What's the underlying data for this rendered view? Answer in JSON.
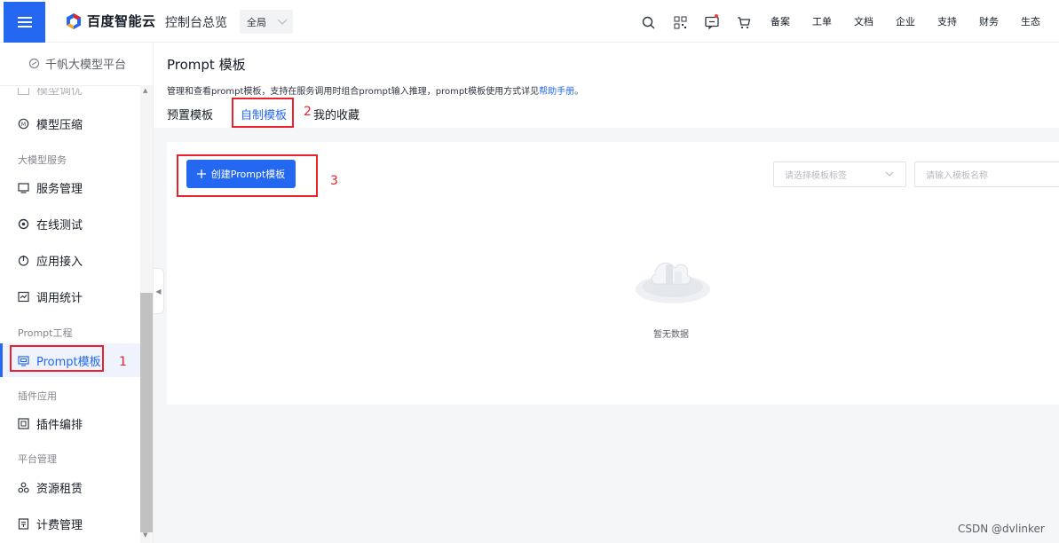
{
  "topbar": {
    "brand": "百度智能云",
    "console_title": "控制台总览",
    "region": "全局",
    "links": [
      "备案",
      "工单",
      "文档",
      "企业",
      "支持",
      "财务",
      "生态"
    ],
    "icons": [
      "search-icon",
      "qrcode-icon",
      "message-icon",
      "cart-icon"
    ]
  },
  "sidebar": {
    "platform": "千帆大模型平台",
    "partial_item": "模型调优",
    "items": [
      {
        "type": "item",
        "label": "模型压缩",
        "icon": "compress-icon"
      },
      {
        "type": "group",
        "label": "大模型服务"
      },
      {
        "type": "item",
        "label": "服务管理",
        "icon": "service-icon"
      },
      {
        "type": "item",
        "label": "在线测试",
        "icon": "test-icon"
      },
      {
        "type": "item",
        "label": "应用接入",
        "icon": "plug-icon"
      },
      {
        "type": "item",
        "label": "调用统计",
        "icon": "stats-icon"
      },
      {
        "type": "group",
        "label": "Prompt工程"
      },
      {
        "type": "item",
        "label": "Prompt模板",
        "icon": "template-icon",
        "active": true
      },
      {
        "type": "group",
        "label": "插件应用"
      },
      {
        "type": "item",
        "label": "插件编排",
        "icon": "plugin-icon"
      },
      {
        "type": "group",
        "label": "平台管理"
      },
      {
        "type": "item",
        "label": "资源租赁",
        "icon": "resource-icon"
      },
      {
        "type": "item",
        "label": "计费管理",
        "icon": "billing-icon"
      }
    ]
  },
  "main": {
    "title": "Prompt 模板",
    "description": "管理和查看prompt模板，支持在服务调用时组合prompt输入推理，prompt模板使用方式详见",
    "help_link": "帮助手册",
    "description_end": "。",
    "tabs": [
      "预置模板",
      "自制模板",
      "我的收藏"
    ],
    "active_tab": 1,
    "create_button": "创建Prompt模板",
    "tag_select_placeholder": "请选择模板标签",
    "name_search_placeholder": "请输入模板名称",
    "empty_text": "暂无数据"
  },
  "annotations": [
    "1",
    "2",
    "3"
  ],
  "watermark": "CSDN @dvlinker",
  "colors": {
    "primary": "#2468f2",
    "annotation": "#e8232e",
    "active_bg": "#eef3fe"
  }
}
